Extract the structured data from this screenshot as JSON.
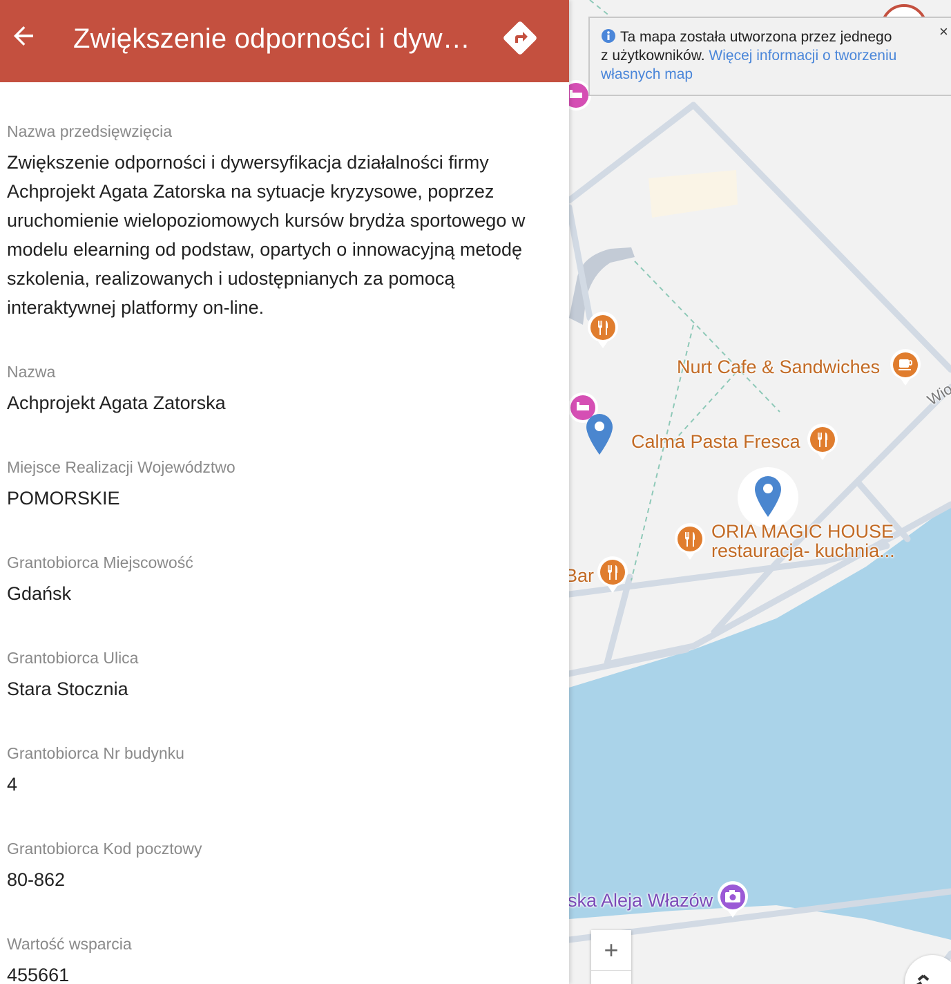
{
  "header": {
    "title": "Zwiększenie odporności i dyw…",
    "background": "#c4503f"
  },
  "fields": [
    {
      "label": "Nazwa przedsięwzięcia",
      "value": "Zwiększenie odporności i dywersyfikacja działalności firmy Achprojekt Agata Zatorska na sytuacje kryzysowe, poprzez uruchomienie wielopoziomowych kursów brydża sportowego w modelu elearning od podstaw, opartych o innowacyjną metodę szkolenia, realizowanych i udostępnianych za pomocą interaktywnej platformy on-line."
    },
    {
      "label": "Nazwa",
      "value": "Achprojekt Agata Zatorska"
    },
    {
      "label": "Miejsce Realizacji Województwo",
      "value": "POMORSKIE"
    },
    {
      "label": "Grantobiorca Miejscowość",
      "value": "Gdańsk"
    },
    {
      "label": "Grantobiorca Ulica",
      "value": "Stara Stocznia"
    },
    {
      "label": "Grantobiorca Nr budynku",
      "value": "4"
    },
    {
      "label": "Grantobiorca Kod pocztowy",
      "value": "80-862"
    },
    {
      "label": "Wartość wsparcia",
      "value": "455661"
    }
  ],
  "map": {
    "notice": {
      "text_1": "Ta mapa została utworzona przez jednego",
      "text_2": "z użytkowników.",
      "link": "Więcej informacji o tworzeniu własnych map",
      "close": "×"
    },
    "places": [
      {
        "label": "Nurt Cafe & Sandwiches",
        "icon": "coffee-icon"
      },
      {
        "label": "Calma Pasta Fresca",
        "icon": "restaurant-icon"
      },
      {
        "label": "ORIA MAGIC HOUSE",
        "icon": "restaurant-icon"
      },
      {
        "label": "restauracja- kuchnia...",
        "icon": "restaurant-icon"
      },
      {
        "label": "Bar",
        "icon": "restaurant-icon"
      },
      {
        "label": "ska Aleja Włazów",
        "icon": "camera-icon"
      },
      {
        "label": "Wio",
        "icon": ""
      }
    ],
    "zoom_in": "+",
    "colors": {
      "water": "#aad3e9",
      "road": "#d2dae4",
      "poi_food": "#e07d2e",
      "poi_hotel": "#d54fb4",
      "poi_photo": "#9b59d6",
      "marker": "#4a86cf"
    }
  }
}
